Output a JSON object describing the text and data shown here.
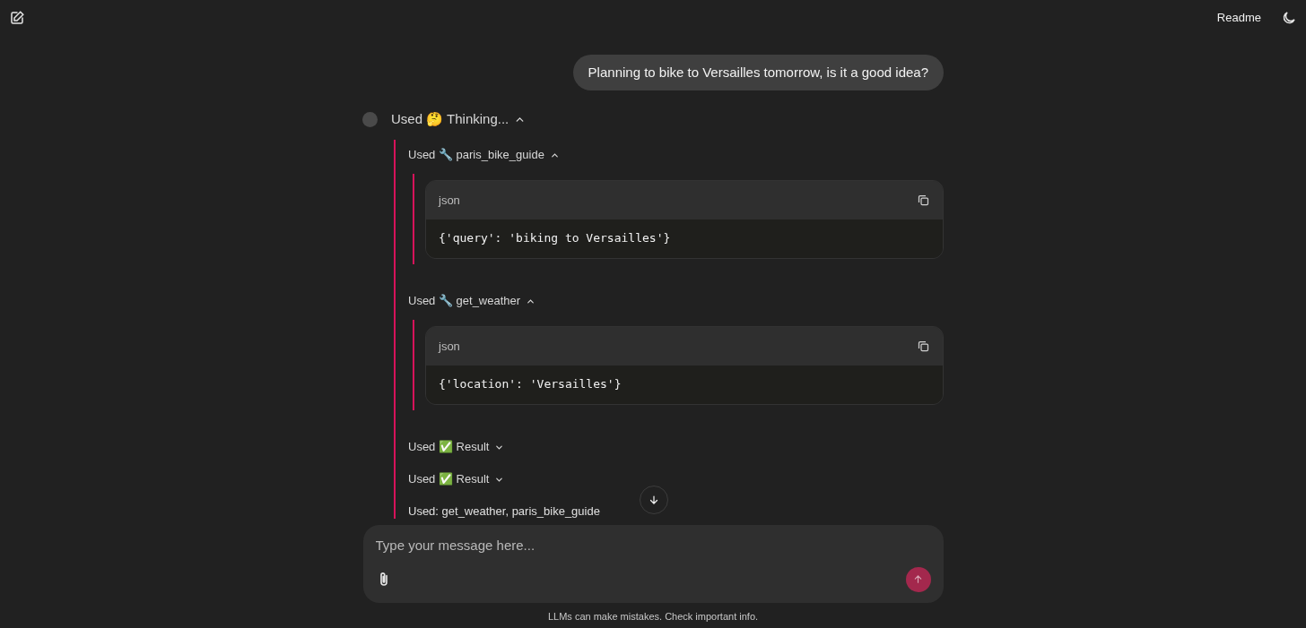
{
  "header": {
    "readme_link": "Readme"
  },
  "user_messages": [
    {
      "text": "Planning to bike to Versailles tomorrow, is it a good idea?"
    }
  ],
  "thinking": {
    "label": "Used 🤔 Thinking...",
    "expanded": true,
    "steps": [
      {
        "kind": "tool",
        "label": "Used 🔧 paris_bike_guide",
        "expanded": true,
        "code": {
          "language": "json",
          "content": "{'query': 'biking to Versailles'}"
        }
      },
      {
        "kind": "tool",
        "label": "Used 🔧 get_weather",
        "expanded": true,
        "code": {
          "language": "json",
          "content": "{'location': 'Versailles'}"
        }
      },
      {
        "kind": "result",
        "label": "Used ✅ Result",
        "expanded": false
      },
      {
        "kind": "result",
        "label": "Used ✅ Result",
        "expanded": false
      },
      {
        "kind": "text",
        "text": "Used: get_weather, paris_bike_guide"
      }
    ]
  },
  "composer": {
    "placeholder": "Type your message here..."
  },
  "disclaimer": "LLMs can make mistakes. Check important info."
}
